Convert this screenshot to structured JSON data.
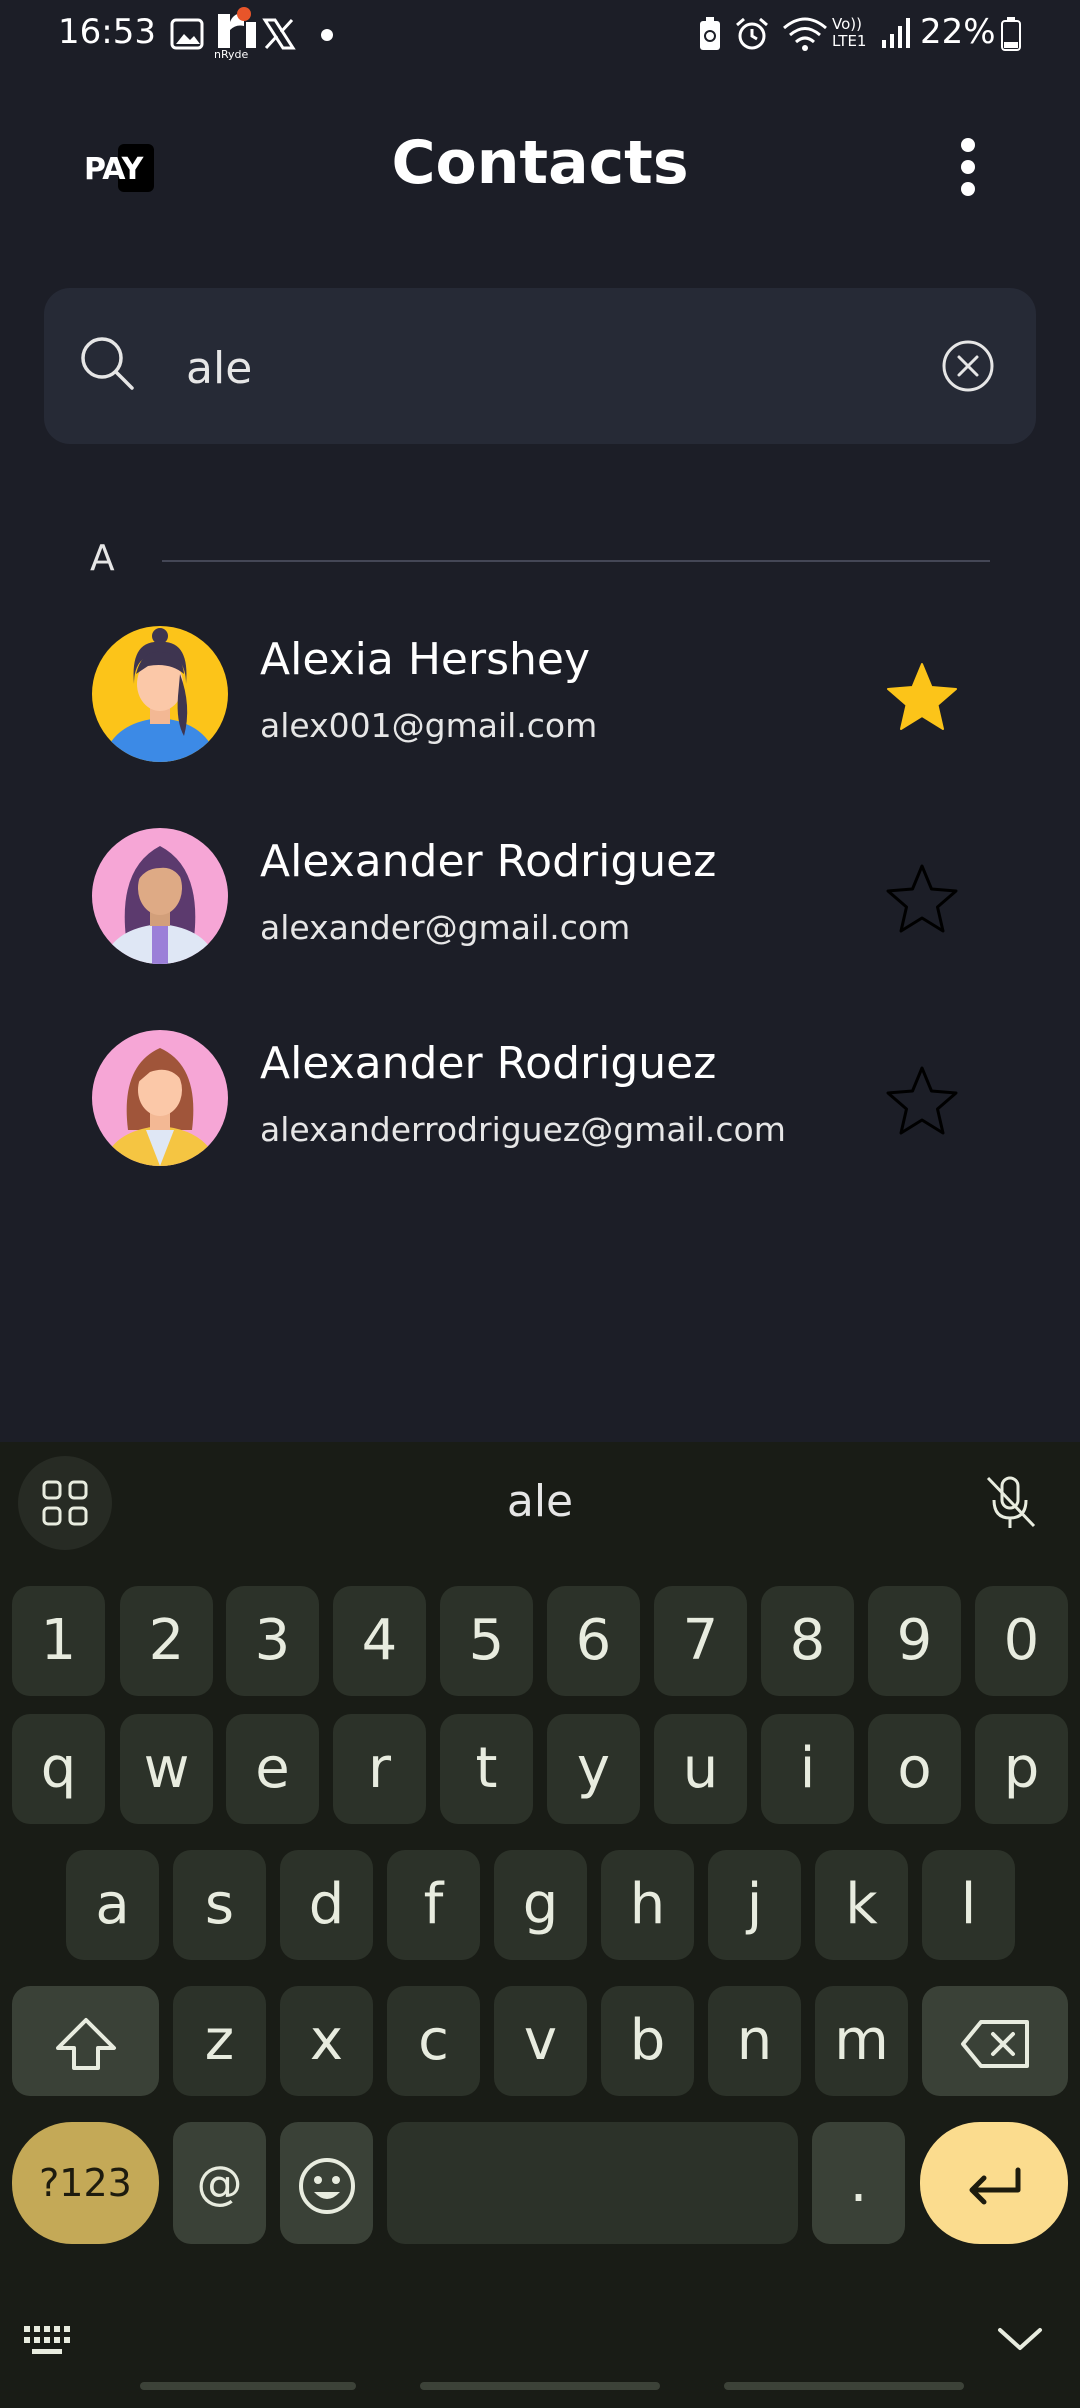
{
  "status_bar": {
    "time": "16:53",
    "battery": "22%",
    "app_badge": "nRyde",
    "icons": [
      "gallery-icon",
      "nryde-icon",
      "x-icon",
      "dot-icon",
      "battery-saver-icon",
      "alarm-icon",
      "wifi-icon",
      "volte-icon",
      "signal-icon",
      "battery-icon"
    ],
    "volte_label": "Vo)) LTE1"
  },
  "header": {
    "logo_text": "PAY",
    "title": "Contacts",
    "menu_icon": "more-vert-icon"
  },
  "search": {
    "value": "ale",
    "icon": "search-icon",
    "clear_icon": "clear-icon"
  },
  "section": {
    "letter": "A"
  },
  "contacts": [
    {
      "name": "Alexia Hershey",
      "email": "alex001@gmail.com",
      "favorite": true
    },
    {
      "name": "Alexander Rodriguez",
      "email": "alexander@gmail.com",
      "favorite": false
    },
    {
      "name": "Alexander Rodriguez",
      "email": "alexanderrodriguez@gmail.com",
      "favorite": false
    }
  ],
  "colors": {
    "background": "#1c1e27",
    "search_bg": "#262a36",
    "star_active": "#fcc419",
    "keyboard_bg": "#191c16",
    "key_bg": "#2c3229",
    "enter_key": "#fbdc8e",
    "symbol_key": "#c4a957"
  },
  "keyboard": {
    "suggestion": "ale",
    "number_row": [
      "1",
      "2",
      "3",
      "4",
      "5",
      "6",
      "7",
      "8",
      "9",
      "0"
    ],
    "row1": [
      "q",
      "w",
      "e",
      "r",
      "t",
      "y",
      "u",
      "i",
      "o",
      "p"
    ],
    "row2": [
      "a",
      "s",
      "d",
      "f",
      "g",
      "h",
      "j",
      "k",
      "l"
    ],
    "row3": [
      "z",
      "x",
      "c",
      "v",
      "b",
      "n",
      "m"
    ],
    "symbols_label": "?123",
    "at_label": "@",
    "period_label": ".",
    "icons": [
      "apps-grid-icon",
      "mic-off-icon",
      "shift-icon",
      "backspace-icon",
      "emoji-icon",
      "enter-icon",
      "keyboard-icon",
      "chevron-down-icon"
    ]
  }
}
